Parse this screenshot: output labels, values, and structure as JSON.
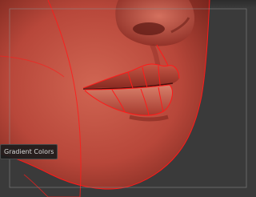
{
  "viewport": {
    "background_color": "#3a3a3a",
    "model_color": "#b8473a",
    "wireframe_color": "#ff1a1a",
    "frame_guide_color": "#8a8a8a"
  },
  "tooltip": {
    "label": "Gradient Colors"
  }
}
